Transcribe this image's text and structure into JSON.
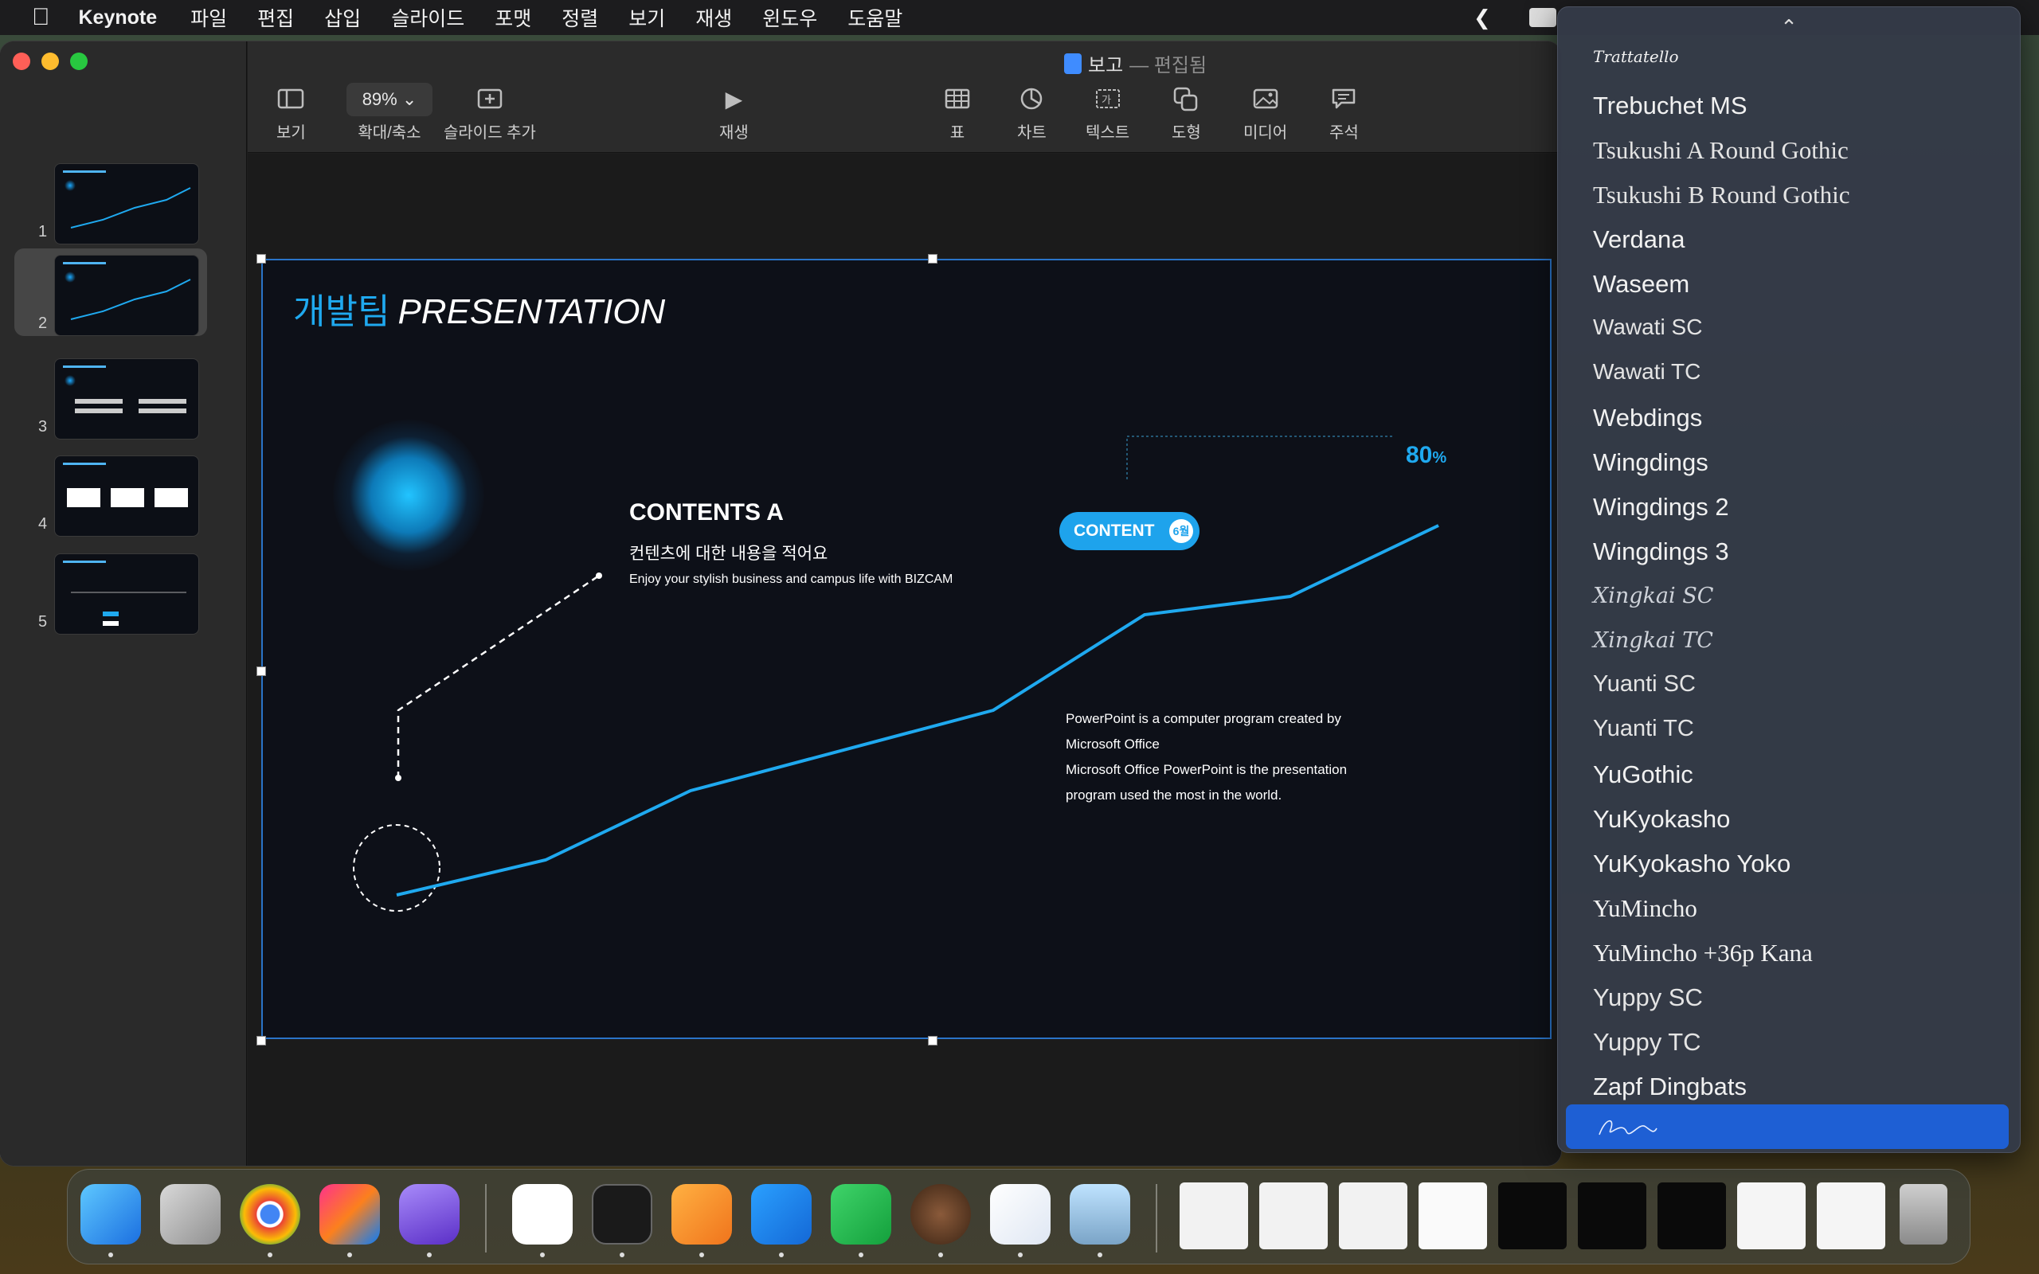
{
  "menubar": {
    "app": "Keynote",
    "items": [
      "파일",
      "편집",
      "삽입",
      "슬라이드",
      "포맷",
      "정렬",
      "보기",
      "재생",
      "윈도우",
      "도움말"
    ]
  },
  "document": {
    "title": "보고",
    "status": "— 편집됨"
  },
  "toolbar": {
    "view": "보기",
    "zoom_value": "89%",
    "zoom_label": "확대/축소",
    "add_slide": "슬라이드 추가",
    "play": "재생",
    "table": "표",
    "chart": "차트",
    "text": "텍스트",
    "shape": "도형",
    "media": "미디어",
    "comment": "주석"
  },
  "slides": [
    {
      "num": "1"
    },
    {
      "num": "2"
    },
    {
      "num": "3"
    },
    {
      "num": "4"
    },
    {
      "num": "5"
    }
  ],
  "slide": {
    "title_kr": "개발팀",
    "title_en": "PRESENTATION",
    "contents_title": "CONTENTS A",
    "contents_sub": "컨텐츠에 대한 내용을 적어요",
    "contents_desc": "Enjoy your stylish business and campus life with BIZCAM",
    "pill_label": "CONTENT",
    "pill_badge": "6월",
    "percent": "80",
    "percent_unit": "%",
    "pp_text_1": "PowerPoint is a computer program created by",
    "pp_text_2": "Microsoft Office",
    "pp_text_3": "Microsoft Office PowerPoint is the presentation",
    "pp_text_4": "program used the most in the world."
  },
  "font_menu": {
    "items": [
      "Trattatello",
      "Trebuchet MS",
      "Tsukushi A Round Gothic",
      "Tsukushi B Round Gothic",
      "Verdana",
      "Waseem",
      "Wawati SC",
      "Wawati TC",
      "Webdings",
      "Wingdings",
      "Wingdings 2",
      "Wingdings 3",
      "Xingkai SC",
      "Xingkai TC",
      "Yuanti SC",
      "Yuanti TC",
      "YuGothic",
      "YuKyokasho",
      "YuKyokasho Yoko",
      "YuMincho",
      "YuMincho +36p Kana",
      "Yuppy SC",
      "Yuppy TC",
      "Zapf Dingbats"
    ],
    "selected": "Zapfino"
  },
  "dock": {
    "apps": [
      "finder-icon",
      "launchpad-icon",
      "chrome-icon",
      "intellij-icon",
      "obsidian-icon",
      "naver-whale-icon",
      "terminal-icon",
      "pages-icon",
      "keynote-icon",
      "numbers-icon",
      "bear-ce-icon",
      "naver-box-icon",
      "preview-icon"
    ],
    "minimized_windows": 9,
    "trash": "trash-icon"
  },
  "colors": {
    "accent": "#1fa9ef",
    "selection": "#1e5fd4",
    "slide_bg": "#0d1018"
  }
}
